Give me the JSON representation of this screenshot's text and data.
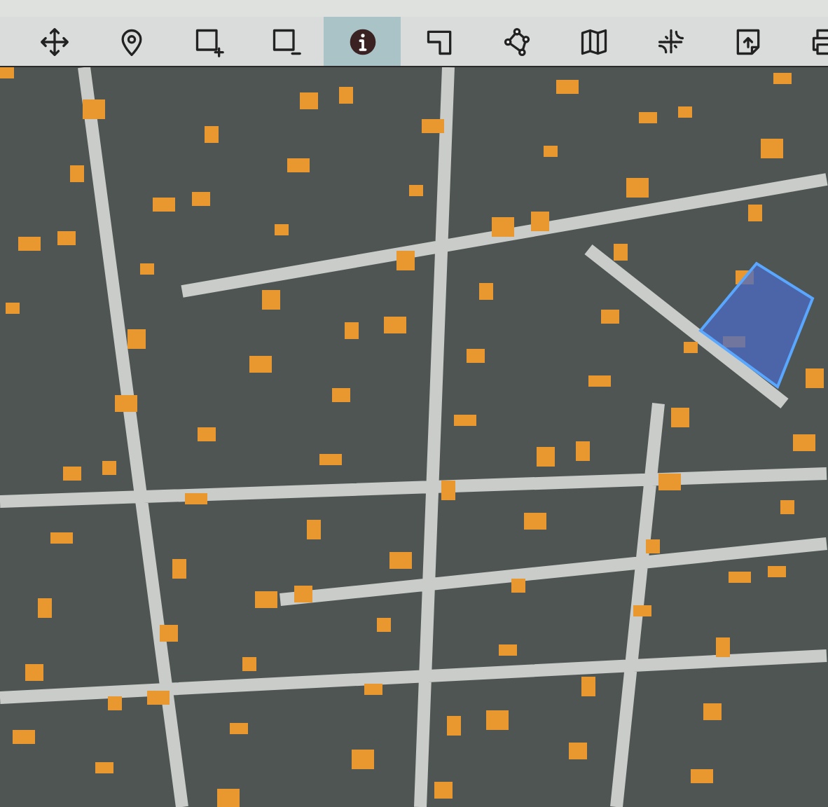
{
  "toolbar": {
    "tools": [
      {
        "kind": "move",
        "selected": false
      },
      {
        "kind": "pin",
        "selected": false
      },
      {
        "kind": "rect-add",
        "selected": false
      },
      {
        "kind": "rect-remove",
        "selected": false
      },
      {
        "kind": "info",
        "selected": true
      },
      {
        "kind": "corner",
        "selected": false
      },
      {
        "kind": "polygon",
        "selected": false
      },
      {
        "kind": "map",
        "selected": false
      },
      {
        "kind": "crosshair",
        "selected": false
      },
      {
        "kind": "upload",
        "selected": false
      },
      {
        "kind": "print",
        "selected": false
      }
    ]
  }
}
